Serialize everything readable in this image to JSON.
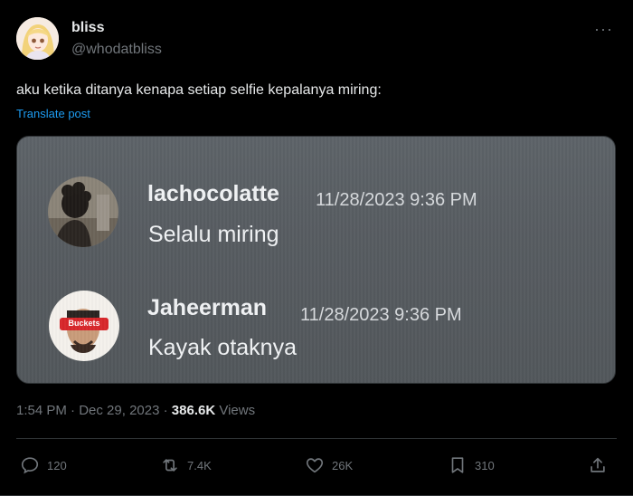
{
  "author": {
    "display_name": "bliss",
    "handle": "@whodatbliss"
  },
  "post": {
    "text": "aku ketika ditanya kenapa setiap selfie kepalanya miring:",
    "translate_label": "Translate post",
    "time": "1:54 PM",
    "date": "Dec 29, 2023",
    "separator": "·",
    "views_count": "386.6K",
    "views_label": "Views"
  },
  "media": {
    "messages": [
      {
        "username": "lachocolatte",
        "timestamp": "11/28/2023 9:36 PM",
        "text": "Selalu miring"
      },
      {
        "username": "Jaheerman",
        "timestamp": "11/28/2023 9:36 PM",
        "text": "Kayak otaknya",
        "avatar_text": "Buckets"
      }
    ]
  },
  "actions": {
    "replies": "120",
    "reposts": "7.4K",
    "likes": "26K",
    "bookmarks": "310"
  },
  "colors": {
    "accent": "#1d9bf0",
    "muted": "#71767b",
    "background": "#000000"
  }
}
